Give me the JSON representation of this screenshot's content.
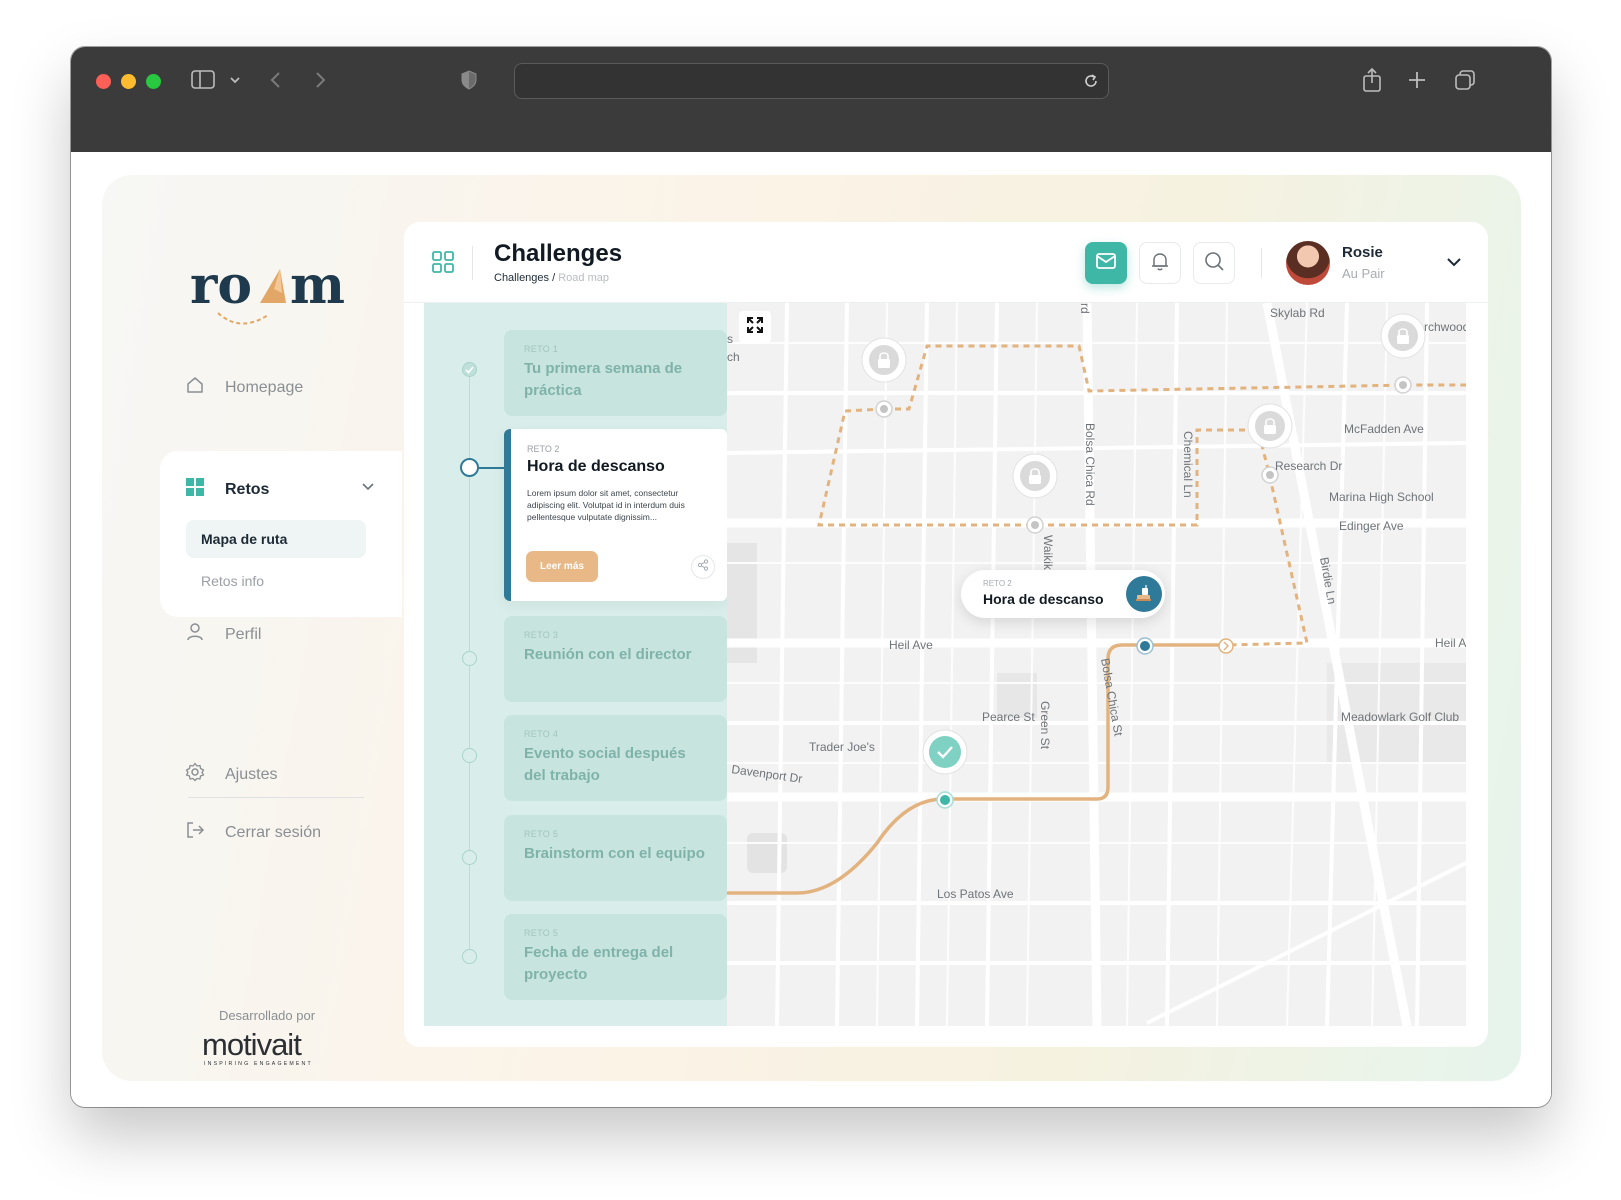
{
  "browser": {
    "url": ""
  },
  "sidebar": {
    "logo_text": "roam",
    "nav": {
      "homepage": "Homepage",
      "retos": "Retos",
      "retos_sub": [
        "Mapa de ruta",
        "Retos info"
      ],
      "perfil": "Perfil",
      "ajustes": "Ajustes",
      "logout": "Cerrar sesión"
    },
    "developed_by": "Desarrollado por",
    "brand": "motivait",
    "brand_tagline": "INSPIRING ENGAGEMENT"
  },
  "header": {
    "title": "Challenges",
    "breadcrumb_current": "Challenges /",
    "breadcrumb_sub": "Road map",
    "user_name": "Rosie",
    "user_role": "Au Pair"
  },
  "challenges": [
    {
      "kicker": "RETO 1",
      "title": "Tu primera semana de práctica",
      "status": "completed"
    },
    {
      "kicker": "RETO 2",
      "title": "Hora de descanso",
      "status": "active",
      "body": "Lorem ipsum dolor sit amet, consectetur adipiscing elit. Volutpat id in interdum duis pellentesque vulputate dignissim...",
      "button": "Leer más"
    },
    {
      "kicker": "RETO 3",
      "title": "Reunión con el director",
      "status": "locked"
    },
    {
      "kicker": "RETO 4",
      "title": "Evento social después del trabajo",
      "status": "locked"
    },
    {
      "kicker": "RETO 5",
      "title": "Brainstorm con el equipo",
      "status": "locked"
    },
    {
      "kicker": "RETO 5",
      "title": "Fecha de entrega del proyecto",
      "status": "locked"
    }
  ],
  "map": {
    "popup_kicker": "RETO 2",
    "popup_title": "Hora de descanso",
    "streets": [
      "Skylab Rd",
      "rchwood",
      "McFadden Ave",
      "Research Dr",
      "Marina High School",
      "Edinger Ave",
      "Bolsa Chica Rd",
      "Chemical Ln",
      "Waikiki",
      "Birdie Ln",
      "Heil Ave",
      "Heil A",
      "Meadowlark Golf Club",
      "Pearce St",
      "Green St",
      "Bolsa Chica St",
      "Trader Joe's",
      "Davenport Dr",
      "Los Patos Ave",
      "ch",
      "s",
      "rd"
    ],
    "route_color": "#e2b37e",
    "accent": "#3fb7a7"
  },
  "colors": {
    "teal": "#3fb7a7",
    "blue": "#2f7a98",
    "orange": "#e9b887",
    "navy": "#1f3a4d"
  }
}
